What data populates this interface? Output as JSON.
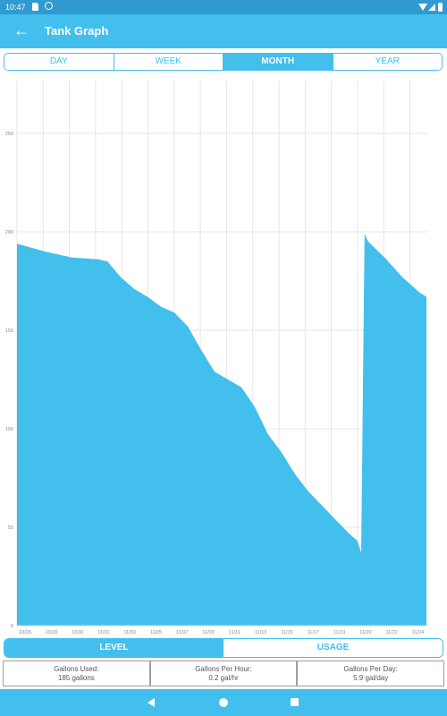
{
  "status_bar": {
    "time": "10:47",
    "icons": [
      "sd-card-icon",
      "sync-icon",
      "wifi-icon",
      "signal-icon",
      "battery-icon"
    ]
  },
  "app_bar": {
    "back_icon": "arrow-left-icon",
    "back_glyph": "←",
    "title": "Tank Graph"
  },
  "range_tabs": [
    {
      "label": "DAY",
      "active": false
    },
    {
      "label": "WEEK",
      "active": false
    },
    {
      "label": "MONTH",
      "active": true
    },
    {
      "label": "YEAR",
      "active": false
    }
  ],
  "mode_tabs": [
    {
      "label": "LEVEL",
      "active": true
    },
    {
      "label": "USAGE",
      "active": false
    }
  ],
  "stats": [
    {
      "label": "Gallons Used:",
      "value": "185 gallons"
    },
    {
      "label": "Gallons Per Hour:",
      "value": "0.2 gal/hr"
    },
    {
      "label": "Gallons Per Day:",
      "value": "5.9 gal/day"
    }
  ],
  "nav_bar": {
    "back": "nav-back-icon",
    "home": "nav-home-icon",
    "recents": "nav-recents-icon"
  },
  "colors": {
    "accent": "#42bfec",
    "status_bar": "#2f9bd0",
    "fill": "#42bfec",
    "grid": "#e6e6e6"
  },
  "chart_data": {
    "type": "area",
    "title": "",
    "xlabel": "",
    "ylabel": "",
    "ylim": [
      0,
      275
    ],
    "yticks": [
      0,
      50,
      100,
      150,
      200,
      250
    ],
    "grid": true,
    "legend": "none",
    "xtick_labels": [
      "10/26",
      "10/28",
      "10/30",
      "11/01",
      "11/03",
      "11/05",
      "11/07",
      "11/09",
      "11/11",
      "11/13",
      "11/15",
      "11/17",
      "11/19",
      "11/20",
      "11/22",
      "11/24"
    ],
    "x_units": "tick index (0 = 10/26, 15 = 11/24)",
    "xlim": [
      0,
      15.66
    ],
    "series": [
      {
        "name": "Level",
        "x": [
          0,
          1.06,
          2.08,
          3.11,
          3.45,
          3.96,
          4.47,
          4.98,
          5.49,
          6.01,
          6.52,
          7.03,
          7.54,
          8.05,
          8.57,
          9.08,
          9.59,
          10.1,
          10.61,
          11.13,
          11.64,
          12.15,
          12.66,
          13.0,
          13.14,
          13.27,
          13.41,
          14.03,
          14.71,
          15.39,
          15.63
        ],
        "values": [
          194,
          190,
          187,
          186,
          185,
          177,
          171,
          167,
          162,
          159,
          152,
          140,
          129,
          125,
          121,
          111,
          97,
          88,
          77,
          68,
          61,
          54,
          47,
          43,
          37,
          199,
          195,
          187,
          177,
          169,
          167
        ]
      }
    ]
  }
}
